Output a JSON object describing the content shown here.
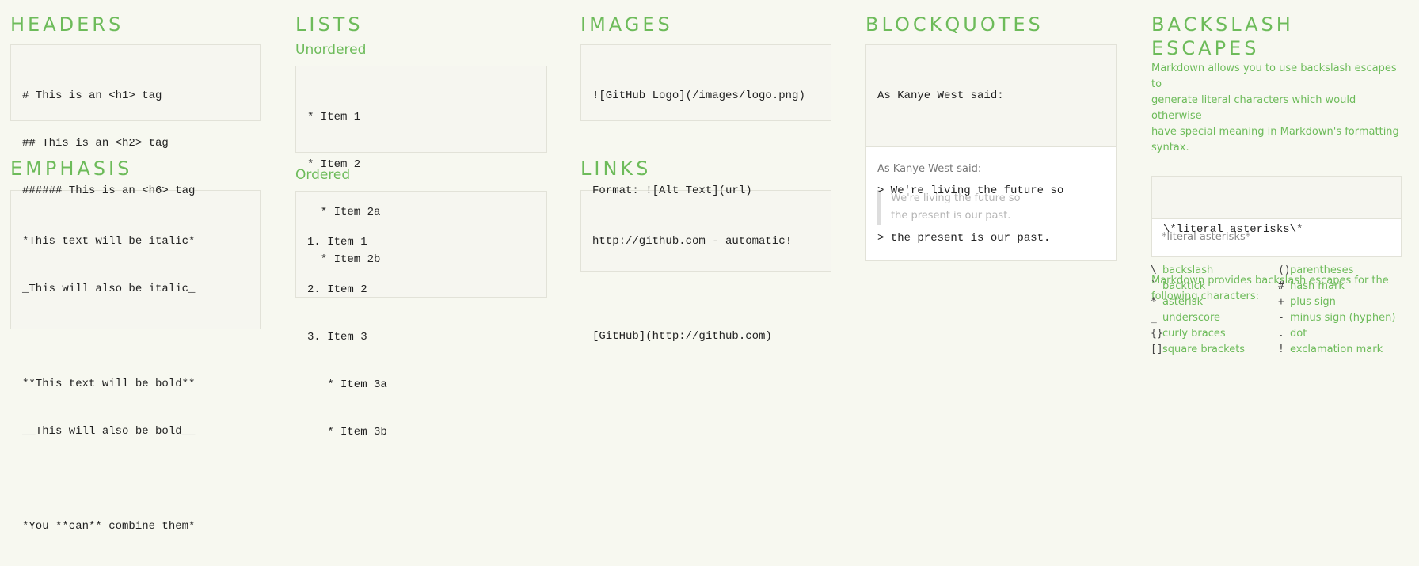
{
  "headers": {
    "title": "HEADERS",
    "lines": [
      "# This is an <h1> tag",
      "## This is an <h2> tag",
      "###### This is an <h6> tag"
    ]
  },
  "emphasis": {
    "title": "EMPHASIS",
    "lines": [
      "*This text will be italic*",
      "_This will also be italic_",
      "",
      "**This text will be bold**",
      "__This will also be bold__",
      "",
      "*You **can** combine them*"
    ]
  },
  "lists": {
    "title": "LISTS",
    "unordered_title": "Unordered",
    "unordered_lines": [
      "* Item 1",
      "* Item 2",
      "  * Item 2a",
      "  * Item 2b"
    ],
    "ordered_title": "Ordered",
    "ordered_lines": [
      "1. Item 1",
      "2. Item 2",
      "3. Item 3",
      "   * Item 3a",
      "   * Item 3b"
    ]
  },
  "images": {
    "title": "IMAGES",
    "lines": [
      "![GitHub Logo](/images/logo.png)",
      "",
      "Format: ![Alt Text](url)"
    ]
  },
  "links": {
    "title": "LINKS",
    "lines": [
      "http://github.com - automatic!",
      "",
      "[GitHub](http://github.com)"
    ]
  },
  "blockquotes": {
    "title": "BLOCKQUOTES",
    "lines": [
      "As Kanye West said:",
      "",
      "> We're living the future so",
      "> the present is our past."
    ],
    "rendered_intro": "As Kanye West said:",
    "rendered_quote": [
      "We're living the future so",
      "the present is our past."
    ]
  },
  "escapes": {
    "title": "BACKSLASH ESCAPES",
    "description": [
      "Markdown allows you to use backslash escapes to",
      "generate literal characters which would otherwise",
      "have special meaning in Markdown's formatting",
      "syntax."
    ],
    "code": "\\*literal asterisks\\*",
    "rendered": "*literal asterisks*",
    "provides": [
      "Markdown provides backslash escapes for the",
      "following characters:"
    ],
    "left": [
      {
        "char": "\\",
        "name": "backslash"
      },
      {
        "char": "`",
        "name": "backtick"
      },
      {
        "char": "*",
        "name": "asterisk"
      },
      {
        "char": "_",
        "name": "underscore"
      },
      {
        "char": "{}",
        "name": "curly braces"
      },
      {
        "char": "[]",
        "name": "square brackets"
      }
    ],
    "right": [
      {
        "char": "()",
        "name": "parentheses"
      },
      {
        "char": "#",
        "name": "hash mark"
      },
      {
        "char": "+",
        "name": "plus sign"
      },
      {
        "char": "-",
        "name": "minus sign (hyphen)"
      },
      {
        "char": ".",
        "name": "dot"
      },
      {
        "char": "!",
        "name": "exclamation mark"
      }
    ]
  }
}
